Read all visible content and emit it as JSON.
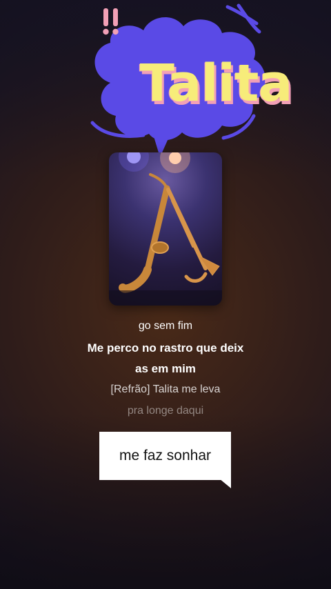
{
  "title": {
    "text": "Talita",
    "bubble_color": "#5a4ae6",
    "text_color": "#f7ec7a",
    "shadow_color": "#f2a0b6",
    "exclaim": "!!"
  },
  "lyrics": [
    "go sem fim",
    "Me perco no rastro que deix",
    "as em mim",
    "[Refrão] Talita me leva",
    "pra longe daqui"
  ],
  "caption": {
    "text": "me faz sonhar"
  }
}
